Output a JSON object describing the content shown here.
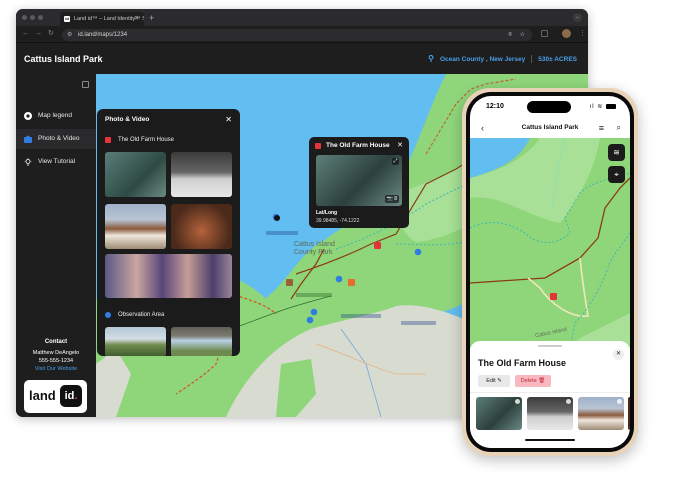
{
  "browser": {
    "tab_title": "Land id™ – Land Identity™ S",
    "tab_favicon": "id",
    "url": "id.land/maps/1234"
  },
  "app": {
    "title": "Cattus Island Park",
    "location": "Ocean County , New Jersey",
    "acreage": "530± ACRES",
    "accent": "#4a9fe8"
  },
  "sidebar": {
    "items": [
      {
        "label": "Map legend",
        "icon": "legend-icon",
        "active": false
      },
      {
        "label": "Photo & Video",
        "icon": "camera-icon",
        "active": true
      },
      {
        "label": "View Tutorial",
        "icon": "lightbulb-icon",
        "active": false
      }
    ],
    "contact": {
      "heading": "Contact",
      "name": "Matthew DeAngelo",
      "phone": "555-555-1234",
      "website_label": "Visit Our Website"
    },
    "logo": {
      "word": "land",
      "mark": "id",
      "dot": "."
    }
  },
  "photo_panel": {
    "title": "Photo & Video",
    "sections": [
      {
        "label": "The Old Farm House",
        "badge_color": "#e2343a",
        "photo_count": 5
      },
      {
        "label": "Observation Area",
        "badge_color": "#2f7de1",
        "photo_count": 2
      }
    ]
  },
  "popup": {
    "title": "The Old Farm House",
    "label": "Lat/Long",
    "value": "39.98485, -74.1222",
    "photo_count": "8"
  },
  "map": {
    "labels": [
      "Cattus Island",
      "County Park"
    ]
  },
  "phone": {
    "time": "12:10",
    "nav_title": "Cattus Island Park",
    "map_label": "Cattus Island",
    "sheet": {
      "title": "The Old Farm House",
      "edit_label": "Edit",
      "delete_label": "Delete"
    }
  }
}
